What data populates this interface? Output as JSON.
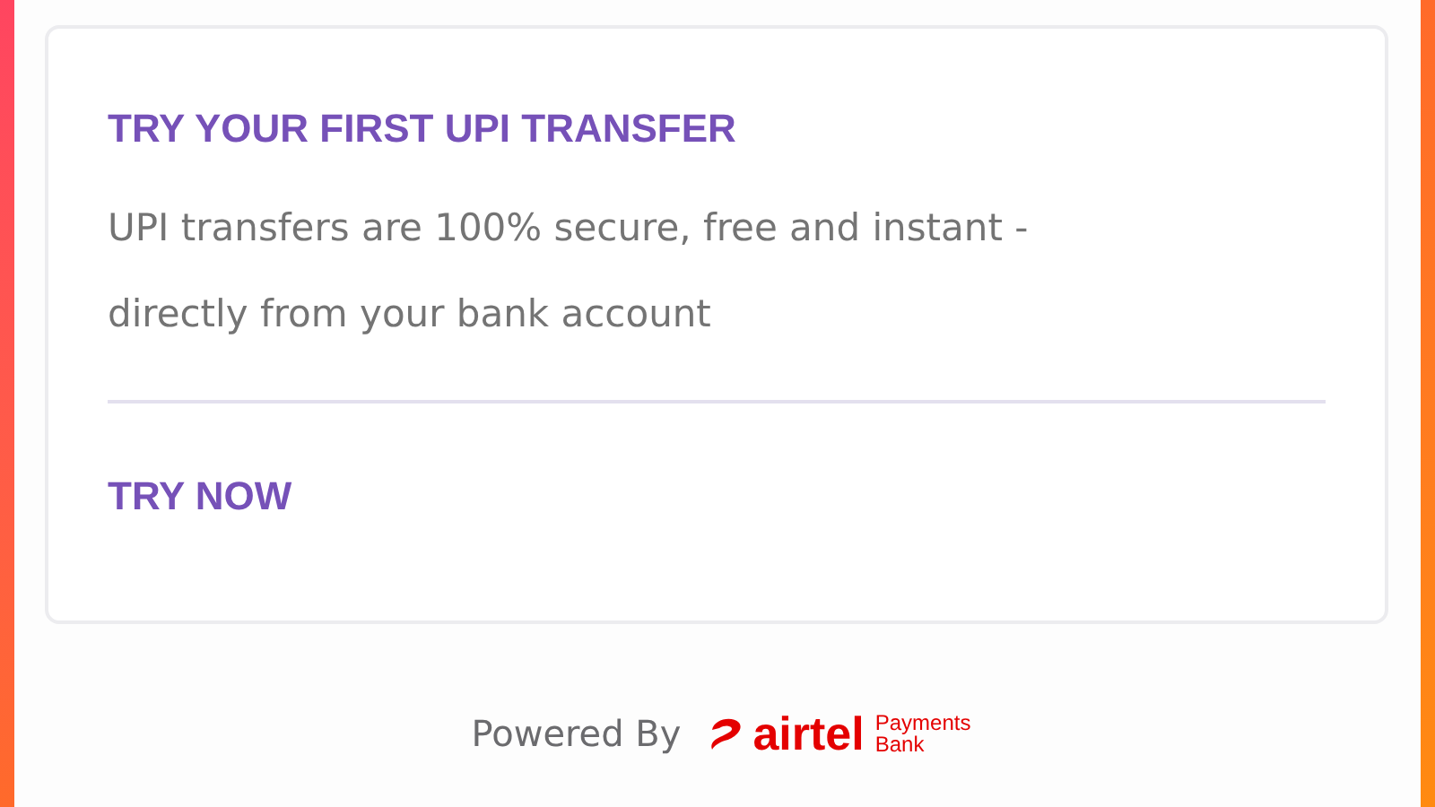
{
  "card": {
    "title": "TRY YOUR FIRST UPI TRANSFER",
    "description": "UPI transfers are 100% secure, free and instant - directly from your bank account",
    "action": "TRY NOW"
  },
  "footer": {
    "powered_by": "Powered By",
    "brand": "airtel",
    "brand_sub_1": "Payments",
    "brand_sub_2": "Bank"
  }
}
